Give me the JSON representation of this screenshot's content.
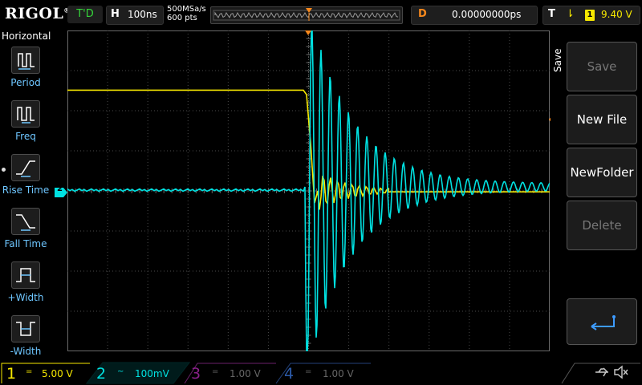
{
  "brand": {
    "logo": "RIGOL"
  },
  "top": {
    "trigger_status": "T'D",
    "horizontal_key": "H",
    "timebase": "100ns",
    "sample_rate": "500MSa/s",
    "points": "600 pts",
    "delay_key": "D",
    "delay": "0.00000000ps",
    "trigger_key": "T",
    "trigger_source": "1",
    "trigger_level": "9.40 V"
  },
  "left_menu": {
    "title": "Horizontal",
    "items": [
      {
        "label": "Period",
        "icon": "period-icon"
      },
      {
        "label": "Freq",
        "icon": "frequency-icon"
      },
      {
        "label": "Rise Time",
        "icon": "rise-time-icon"
      },
      {
        "label": "Fall Time",
        "icon": "fall-time-icon"
      },
      {
        "label": "+Width",
        "icon": "positive-width-icon"
      },
      {
        "label": "-Width",
        "icon": "negative-width-icon"
      }
    ]
  },
  "right_menu": {
    "tab": "Save",
    "buttons": [
      {
        "label": "Save",
        "enabled": false
      },
      {
        "label": "New File",
        "enabled": true
      },
      {
        "label": "NewFolder",
        "enabled": true
      },
      {
        "label": "Delete",
        "enabled": false
      }
    ],
    "back_icon": "return-arrow-icon"
  },
  "channels": [
    {
      "num": "1",
      "coupling": "=",
      "scale": "5.00 V",
      "color": "#f6e800",
      "active": true
    },
    {
      "num": "2",
      "coupling": "~",
      "scale": "100mV",
      "color": "#00e1e1",
      "active": true
    },
    {
      "num": "3",
      "coupling": "=",
      "scale": "1.00 V",
      "color": "#c020c0",
      "active": false
    },
    {
      "num": "4",
      "coupling": "=",
      "scale": "1.00 V",
      "color": "#3d7aff",
      "active": false
    }
  ],
  "status_icons": [
    "usb-icon",
    "mute-speaker-icon"
  ],
  "markers": {
    "ch2_marker": "2",
    "trigger_marker": "T"
  },
  "colors": {
    "ch1": "#f6e800",
    "ch2": "#00e1e1",
    "trigger": "#f6881d",
    "grid": "#5a5a5a"
  }
}
